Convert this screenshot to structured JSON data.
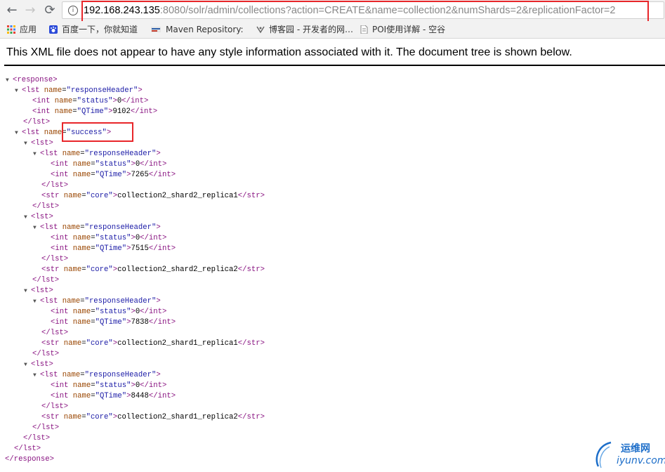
{
  "browser": {
    "nav_icons": {
      "back": "←",
      "forward": "→",
      "reload": "⟳"
    },
    "info": "i",
    "url_host": "192.168.243.135",
    "url_rest": ":8080/solr/admin/collections?action=CREATE&name=collection2&numShards=2&replicationFactor=2",
    "bookmarks": [
      {
        "icon": "apps-grid-icon",
        "label": "应用"
      },
      {
        "icon": "baidu-paw-icon",
        "label": "百度一下，你就知道"
      },
      {
        "icon": "maven-icon",
        "label": "Maven Repository:"
      },
      {
        "icon": "cnblogs-icon",
        "label": "博客园 - 开发者的网…"
      },
      {
        "icon": "document-icon",
        "label": "POI使用详解 - 空谷"
      }
    ]
  },
  "page": {
    "xml_message": "This XML file does not appear to have any style information associated with it. The document tree is shown below.",
    "xml_lines": [
      {
        "toggle": "▼",
        "pre": "<",
        "tag": "response",
        "post": ">"
      },
      {
        "toggle": "▼",
        "pre": "<",
        "tag": "lst",
        "attr": "name",
        "val": "\"responseHeader\"",
        "post": ">"
      },
      {
        "pre": "<",
        "tag": "int",
        "attr": "name",
        "val": "\"status\"",
        "post": ">",
        "text": "0",
        "close": "int"
      },
      {
        "pre": "<",
        "tag": "int",
        "attr": "name",
        "val": "\"QTime\"",
        "post": ">",
        "text": "9102",
        "close": "int"
      },
      {
        "pre": "</",
        "tag": "lst",
        "post": ">"
      },
      {
        "toggle": "▼",
        "pre": "<",
        "tag": "lst",
        "attr": "name",
        "val": "\"success\"",
        "post": ">"
      },
      {
        "toggle": "▼",
        "pre": "<",
        "tag": "lst",
        "post": ">"
      },
      {
        "toggle": "▼",
        "pre": "<",
        "tag": "lst",
        "attr": "name",
        "val": "\"responseHeader\"",
        "post": ">"
      },
      {
        "pre": "<",
        "tag": "int",
        "attr": "name",
        "val": "\"status\"",
        "post": ">",
        "text": "0",
        "close": "int"
      },
      {
        "pre": "<",
        "tag": "int",
        "attr": "name",
        "val": "\"QTime\"",
        "post": ">",
        "text": "7265",
        "close": "int"
      },
      {
        "pre": "</",
        "tag": "lst",
        "post": ">"
      },
      {
        "pre": "<",
        "tag": "str",
        "attr": "name",
        "val": "\"core\"",
        "post": ">",
        "text": "collection2_shard2_replica1",
        "close": "str"
      },
      {
        "pre": "</",
        "tag": "lst",
        "post": ">"
      },
      {
        "toggle": "▼",
        "pre": "<",
        "tag": "lst",
        "post": ">"
      },
      {
        "toggle": "▼",
        "pre": "<",
        "tag": "lst",
        "attr": "name",
        "val": "\"responseHeader\"",
        "post": ">"
      },
      {
        "pre": "<",
        "tag": "int",
        "attr": "name",
        "val": "\"status\"",
        "post": ">",
        "text": "0",
        "close": "int"
      },
      {
        "pre": "<",
        "tag": "int",
        "attr": "name",
        "val": "\"QTime\"",
        "post": ">",
        "text": "7515",
        "close": "int"
      },
      {
        "pre": "</",
        "tag": "lst",
        "post": ">"
      },
      {
        "pre": "<",
        "tag": "str",
        "attr": "name",
        "val": "\"core\"",
        "post": ">",
        "text": "collection2_shard2_replica2",
        "close": "str"
      },
      {
        "pre": "</",
        "tag": "lst",
        "post": ">"
      },
      {
        "toggle": "▼",
        "pre": "<",
        "tag": "lst",
        "post": ">"
      },
      {
        "toggle": "▼",
        "pre": "<",
        "tag": "lst",
        "attr": "name",
        "val": "\"responseHeader\"",
        "post": ">"
      },
      {
        "pre": "<",
        "tag": "int",
        "attr": "name",
        "val": "\"status\"",
        "post": ">",
        "text": "0",
        "close": "int"
      },
      {
        "pre": "<",
        "tag": "int",
        "attr": "name",
        "val": "\"QTime\"",
        "post": ">",
        "text": "7838",
        "close": "int"
      },
      {
        "pre": "</",
        "tag": "lst",
        "post": ">"
      },
      {
        "pre": "<",
        "tag": "str",
        "attr": "name",
        "val": "\"core\"",
        "post": ">",
        "text": "collection2_shard1_replica1",
        "close": "str"
      },
      {
        "pre": "</",
        "tag": "lst",
        "post": ">"
      },
      {
        "toggle": "▼",
        "pre": "<",
        "tag": "lst",
        "post": ">"
      },
      {
        "toggle": "▼",
        "pre": "<",
        "tag": "lst",
        "attr": "name",
        "val": "\"responseHeader\"",
        "post": ">"
      },
      {
        "pre": "<",
        "tag": "int",
        "attr": "name",
        "val": "\"status\"",
        "post": ">",
        "text": "0",
        "close": "int"
      },
      {
        "pre": "<",
        "tag": "int",
        "attr": "name",
        "val": "\"QTime\"",
        "post": ">",
        "text": "8448",
        "close": "int"
      },
      {
        "pre": "</",
        "tag": "lst",
        "post": ">"
      },
      {
        "pre": "<",
        "tag": "str",
        "attr": "name",
        "val": "\"core\"",
        "post": ">",
        "text": "collection2_shard1_replica2",
        "close": "str"
      },
      {
        "pre": "</",
        "tag": "lst",
        "post": ">"
      },
      {
        "pre": "</",
        "tag": "lst",
        "post": ">"
      },
      {
        "pre": "</",
        "tag": "lst",
        "post": ">"
      },
      {
        "pre": "</",
        "tag": "response",
        "post": ">"
      }
    ]
  },
  "watermark": {
    "title": "运维网",
    "sub": "iyunv.com"
  },
  "colors": {
    "highlight": "#e8262a",
    "tag": "#881280",
    "attr_name": "#994500",
    "attr_value": "#1a1aa6"
  }
}
